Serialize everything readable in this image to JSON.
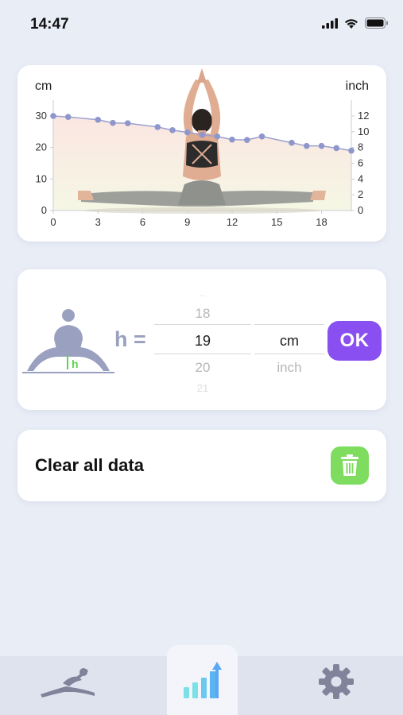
{
  "status_bar": {
    "time": "14:47"
  },
  "chart_card": {
    "unit_left": "cm",
    "unit_right": "inch"
  },
  "chart_data": {
    "type": "line",
    "xlabel": "",
    "ylabel": "cm",
    "y2label": "inch",
    "xlim": [
      0,
      20
    ],
    "ylim": [
      0,
      30
    ],
    "y2lim": [
      0,
      12
    ],
    "x_ticks": [
      "0",
      "3",
      "6",
      "9",
      "12",
      "15",
      "18"
    ],
    "y_ticks": [
      "0",
      "10",
      "20",
      "30"
    ],
    "y2_ticks": [
      "0",
      "2",
      "4",
      "6",
      "8",
      "10",
      "12"
    ],
    "series": [
      {
        "x": [
          0,
          1,
          3,
          4,
          5,
          7,
          8,
          9,
          10,
          11,
          12,
          13,
          14,
          16,
          17,
          18,
          19,
          20
        ],
        "values": [
          30,
          29.7,
          28.8,
          27.8,
          27.7,
          26.5,
          25.5,
          24.8,
          24.0,
          23.5,
          22.5,
          22.4,
          23.5,
          21.5,
          20.5,
          20.5,
          19.8,
          19.0
        ]
      }
    ],
    "grid": false,
    "colors": {
      "line": "#9aa0d0",
      "marker": "#8f96cc",
      "fill_top": "#fbe9e4",
      "fill_bottom": "#f6f7e6"
    }
  },
  "input_card": {
    "h_label": "h =",
    "figure_h_label": "h",
    "number_picker": {
      "above": "18",
      "selected": "19",
      "below": "20",
      "faint_above": "..",
      "faint_below": "21"
    },
    "unit_picker": {
      "selected": "cm",
      "below": "inch"
    },
    "ok_label": "OK"
  },
  "clear_card": {
    "label": "Clear all data"
  },
  "tab_bar": {
    "tabs": [
      {
        "icon": "stretch-exercise-icon",
        "active": false
      },
      {
        "icon": "stats-chart-icon",
        "active": true
      },
      {
        "icon": "gear-icon",
        "active": false
      }
    ]
  },
  "colors": {
    "accent": "#8a4ff0",
    "trash": "#7edc5e",
    "muted_icon": "#9aa0c0",
    "h_green": "#5fd54d"
  }
}
